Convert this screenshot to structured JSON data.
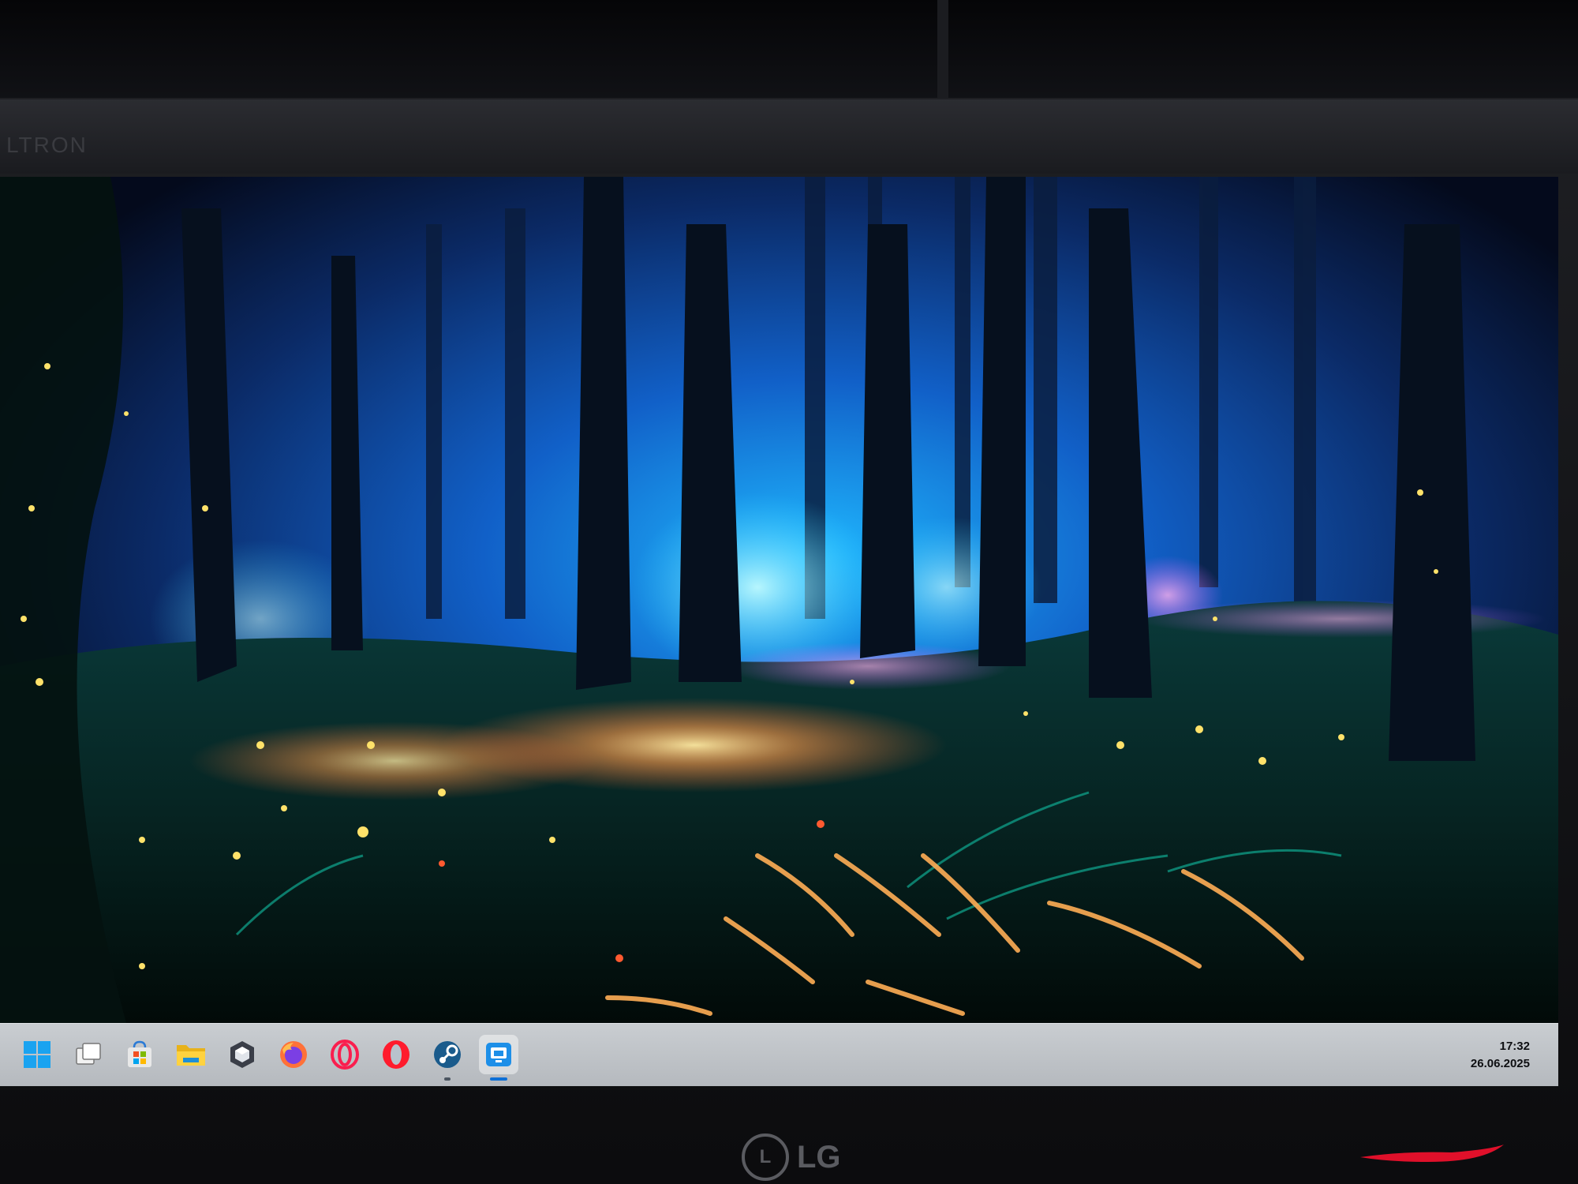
{
  "monitor": {
    "bezel_brand": "LTRON",
    "logo_text": "LG",
    "logo_mark": "L"
  },
  "taskbar": {
    "items": [
      {
        "name": "start-button",
        "icon": "windows-logo-icon"
      },
      {
        "name": "task-view-button",
        "icon": "task-view-icon"
      },
      {
        "name": "microsoft-store-button",
        "icon": "store-icon"
      },
      {
        "name": "file-explorer-button",
        "icon": "folder-icon"
      },
      {
        "name": "app-hexagon-button",
        "icon": "hexagon-app-icon"
      },
      {
        "name": "firefox-button",
        "icon": "firefox-icon"
      },
      {
        "name": "opera-gx-button",
        "icon": "opera-gx-icon"
      },
      {
        "name": "opera-button",
        "icon": "opera-icon"
      },
      {
        "name": "steam-button",
        "icon": "steam-icon"
      },
      {
        "name": "remote-desktop-button",
        "icon": "remote-desktop-icon"
      }
    ],
    "clock": {
      "time": "17:32",
      "date": "26.06.2025"
    }
  },
  "colors": {
    "taskbar": "#c0c4c8",
    "accent": "#0d6fd6",
    "wallpaper_glow": "#2aa8ff"
  }
}
